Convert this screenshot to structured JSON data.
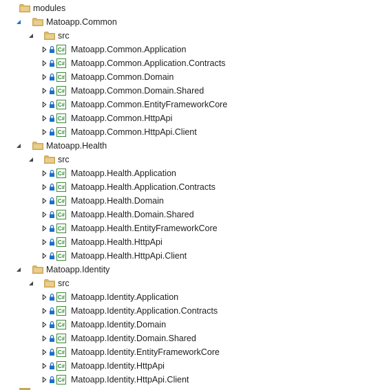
{
  "solution_explorer": {
    "root": {
      "label": "modules",
      "icon": "folder-icon",
      "expanded": true,
      "children": [
        {
          "label": "Matoapp.Common",
          "icon": "folder-icon",
          "expanded": true,
          "selected": false,
          "src": {
            "label": "src",
            "icon": "folder-icon",
            "expanded": true,
            "projects": [
              "Matoapp.Common.Application",
              "Matoapp.Common.Application.Contracts",
              "Matoapp.Common.Domain",
              "Matoapp.Common.Domain.Shared",
              "Matoapp.Common.EntityFrameworkCore",
              "Matoapp.Common.HttpApi",
              "Matoapp.Common.HttpApi.Client"
            ]
          }
        },
        {
          "label": "Matoapp.Health",
          "icon": "folder-icon",
          "expanded": true,
          "selected": false,
          "src": {
            "label": "src",
            "icon": "folder-icon",
            "expanded": true,
            "projects": [
              "Matoapp.Health.Application",
              "Matoapp.Health.Application.Contracts",
              "Matoapp.Health.Domain",
              "Matoapp.Health.Domain.Shared",
              "Matoapp.Health.EntityFrameworkCore",
              "Matoapp.Health.HttpApi",
              "Matoapp.Health.HttpApi.Client"
            ]
          }
        },
        {
          "label": "Matoapp.Identity",
          "icon": "folder-icon",
          "expanded": true,
          "selected": false,
          "src": {
            "label": "src",
            "icon": "folder-icon",
            "expanded": true,
            "projects": [
              "Matoapp.Identity.Application",
              "Matoapp.Identity.Application.Contracts",
              "Matoapp.Identity.Domain",
              "Matoapp.Identity.Domain.Shared",
              "Matoapp.Identity.EntityFrameworkCore",
              "Matoapp.Identity.HttpApi",
              "Matoapp.Identity.HttpApi.Client"
            ]
          }
        }
      ]
    },
    "project_icon": "csharp-project-icon",
    "project_lock_icon": "lock-icon",
    "colors": {
      "folder": "#dcb967",
      "folder_dark": "#c9a659",
      "expanded_arrow_blue": "#1e6fc9",
      "expanded_arrow_dark": "#444444",
      "csharp_green": "#388a34",
      "lock_blue": "#1e6fc9",
      "selection": "#cce8ff"
    }
  }
}
